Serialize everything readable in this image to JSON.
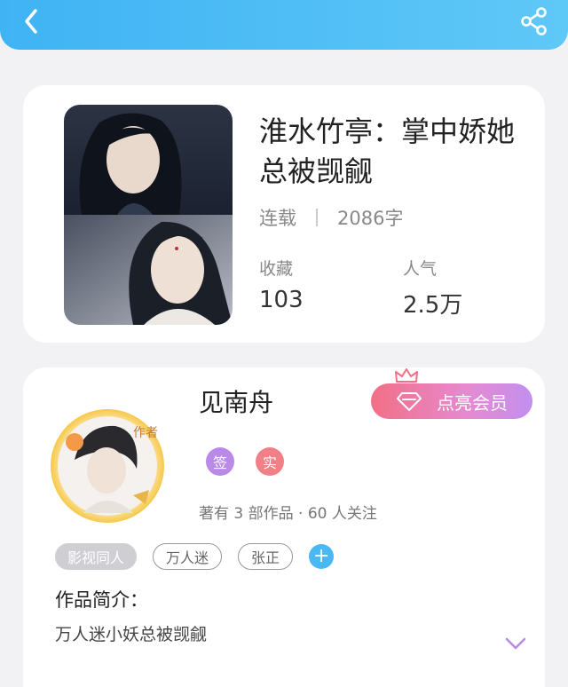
{
  "header": {
    "back_icon": "chevron-left-icon",
    "share_icon": "share-icon",
    "bg_color": "#4dbdf5"
  },
  "book": {
    "title": "淮水竹亭：掌中娇她总被觊觎",
    "status": "连载",
    "word_count": "2086字",
    "favorites_label": "收藏",
    "favorites_value": "103",
    "popularity_label": "人气",
    "popularity_value": "2.5万"
  },
  "author": {
    "name": "见南舟",
    "vip_button_label": "点亮会员",
    "avatar_badge": "作者",
    "badge_signed": "签",
    "badge_verified": "实",
    "works_summary": "著有 3 部作品 · 60 人关注",
    "tags": [
      "影视同人",
      "万人迷",
      "张正"
    ],
    "add_tag_label": "+",
    "intro_label": "作品简介：",
    "intro_text": "万人迷小妖总被觊觎"
  },
  "colors": {
    "accent_blue": "#49b8f4",
    "badge_purple": "#b98ae6",
    "badge_red": "#f07f86",
    "vip_gradient_start": "#f26f86",
    "vip_gradient_end": "#c28ff0"
  }
}
